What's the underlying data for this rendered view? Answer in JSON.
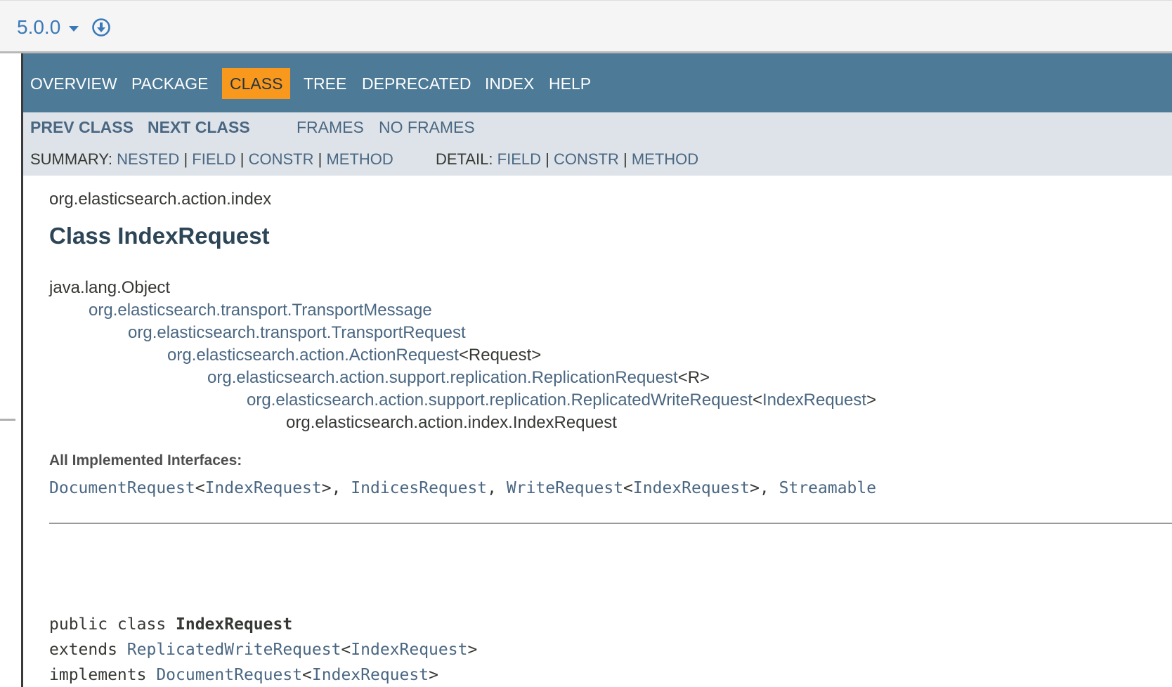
{
  "topbar": {
    "version": "5.0.0"
  },
  "nav": {
    "overview": "OVERVIEW",
    "package": "PACKAGE",
    "class": "CLASS",
    "tree": "TREE",
    "deprecated": "DEPRECATED",
    "index": "INDEX",
    "help": "HELP"
  },
  "subnav": {
    "prev_class": "PREV CLASS",
    "next_class": "NEXT CLASS",
    "frames": "FRAMES",
    "no_frames": "NO FRAMES",
    "summary_label": "SUMMARY:",
    "summary_nested": "NESTED",
    "summary_field": "FIELD",
    "summary_constr": "CONSTR",
    "summary_method": "METHOD",
    "detail_label": "DETAIL:",
    "detail_field": "FIELD",
    "detail_constr": "CONSTR",
    "detail_method": "METHOD",
    "separator": "|"
  },
  "content": {
    "package_name": "org.elasticsearch.action.index",
    "class_title": "Class IndexRequest",
    "inheritance": {
      "l0": "java.lang.Object",
      "l1": "org.elasticsearch.transport.TransportMessage",
      "l2": "org.elasticsearch.transport.TransportRequest",
      "l3_link": "org.elasticsearch.action.ActionRequest",
      "l3_suffix": "<Request>",
      "l4_link": "org.elasticsearch.action.support.replication.ReplicationRequest",
      "l4_suffix": "<R>",
      "l5_link": "org.elasticsearch.action.support.replication.ReplicatedWriteRequest",
      "l5_lt": "<",
      "l5_param": "IndexRequest",
      "l5_gt": ">",
      "l6": "org.elasticsearch.action.index.IndexRequest"
    },
    "interfaces_label": "All Implemented Interfaces:",
    "interfaces": {
      "i1": "DocumentRequest",
      "i1_lt": "<",
      "i1_param": "IndexRequest",
      "i1_end": ">, ",
      "i2": "IndicesRequest",
      "i2_end": ", ",
      "i3": "WriteRequest",
      "i3_lt": "<",
      "i3_param": "IndexRequest",
      "i3_end": ">, ",
      "i4": "Streamable"
    },
    "declaration": {
      "line1_kw": "public class ",
      "line1_name": "IndexRequest",
      "line2_kw": "extends ",
      "line2_link": "ReplicatedWriteRequest",
      "line2_lt": "<",
      "line2_param": "IndexRequest",
      "line2_gt": ">",
      "line3_kw": "implements ",
      "line3_link": "DocumentRequest",
      "line3_lt": "<",
      "line3_param": "IndexRequest",
      "line3_gt": ">"
    }
  }
}
